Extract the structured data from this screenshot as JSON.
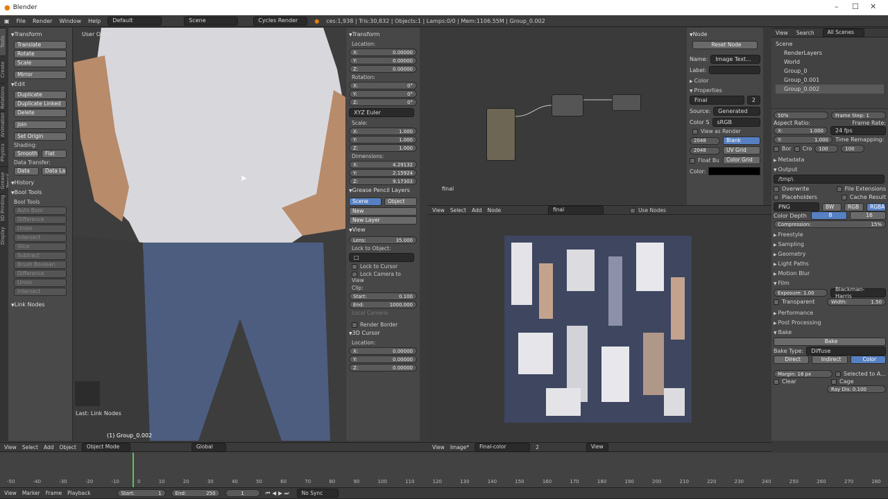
{
  "window": {
    "title": "Blender"
  },
  "menubar": {
    "items": [
      "File",
      "Render",
      "Window",
      "Help"
    ],
    "layout": "Default",
    "scene": "Scene",
    "engine": "Cycles Render",
    "stats": "ces:1,938 | Tris:30,832 | Objects:1 | Lamps:0/0 | Mem:1106.55M | Group_0.002"
  },
  "vtabs": [
    "Tools",
    "Create",
    "Relations",
    "Animation",
    "Physics",
    "Grease Pencil",
    "3D Printing",
    "Display"
  ],
  "toolshelf": {
    "transform": "Transform",
    "translate": "Translate",
    "rotate": "Rotate",
    "scale": "Scale",
    "mirror": "Mirror",
    "edit": "Edit",
    "duplicate": "Duplicate",
    "duplicate_linked": "Duplicate Linked",
    "delete": "Delete",
    "join": "Join",
    "set_origin": "Set Origin",
    "shading": "Shading:",
    "smooth": "Smooth",
    "flat": "Flat",
    "data_transfer": "Data Transfer:",
    "data": "Data",
    "data_la": "Data La",
    "history": "History",
    "bool_tools": "Bool Tools",
    "bool_tools_label": "Bool Tools",
    "bool_items": [
      "Auto Bool",
      "Difference",
      "Union",
      "Intersect",
      "Slice",
      "Subtract",
      "Brush Boolean",
      "Difference",
      "Union",
      "Intersect"
    ],
    "link_nodes": "Link Nodes"
  },
  "viewport": {
    "view_label": "User Ortho",
    "last_op": "Last: Link Nodes",
    "object_label": "(1) Group_0.002"
  },
  "npanel": {
    "transform": "Transform",
    "location": "Location:",
    "loc": [
      {
        "k": "X:",
        "v": "0.00000"
      },
      {
        "k": "Y:",
        "v": "0.00000"
      },
      {
        "k": "Z:",
        "v": "0.00000"
      }
    ],
    "rotation": "Rotation:",
    "rot": [
      {
        "k": "X:",
        "v": "0°"
      },
      {
        "k": "Y:",
        "v": "0°"
      },
      {
        "k": "Z:",
        "v": "0°"
      }
    ],
    "euler": "XYZ Euler",
    "scale": "Scale:",
    "scl": [
      {
        "k": "X:",
        "v": "1.000"
      },
      {
        "k": "Y:",
        "v": "1.000"
      },
      {
        "k": "Z:",
        "v": "1.000"
      }
    ],
    "dimensions": "Dimensions:",
    "dim": [
      {
        "k": "X:",
        "v": "4.29132"
      },
      {
        "k": "Y:",
        "v": "2.15924"
      },
      {
        "k": "Z:",
        "v": "9.17303"
      }
    ],
    "grease": "Grease Pencil Layers",
    "scene_btn": "Scene",
    "object_btn": "Object",
    "new": "New",
    "new_layer": "New Layer",
    "view": "View",
    "lens_k": "Lens:",
    "lens_v": "35.000",
    "lock_object": "Lock to Object:",
    "lock_cursor": "Lock to Cursor",
    "lock_camera": "Lock Camera to View",
    "clip": "Clip:",
    "start_k": "Start:",
    "start_v": "0.100",
    "end_k": "End:",
    "end_v": "1000.000",
    "local_camera": "Local Camera:",
    "render_border": "Render Border",
    "cursor3d": "3D Cursor",
    "cur_loc": "Location:",
    "cur": [
      {
        "k": "X:",
        "v": "0.00000"
      },
      {
        "k": "Y:",
        "v": "0.00000"
      },
      {
        "k": "Z:",
        "v": "0.00000"
      }
    ]
  },
  "nodeeditor": {
    "label": "final",
    "header": [
      "View",
      "Select",
      "Add",
      "Node"
    ],
    "tree": "final",
    "use_nodes": "Use Nodes"
  },
  "nodeprops": {
    "node": "Node",
    "reset": "Reset Node",
    "name_k": "Name:",
    "name_v": "Image Text...",
    "label_k": "Label:",
    "color": "Color",
    "properties": "Properties",
    "final": "Final",
    "final_num": "2",
    "source_k": "Source:",
    "source_v": "Generated",
    "colors_k": "Color S",
    "colors_v": "sRGB",
    "view_render": "View as Render",
    "w": "2048",
    "h": "2048",
    "blank": "Blank",
    "uvgrid": "UV Grid",
    "colorgrid": "Color Grid",
    "float": "Float Bu",
    "color_k": "Color:"
  },
  "outliner": {
    "header": [
      "View",
      "Search"
    ],
    "filter": "All Scenes",
    "items": [
      {
        "label": "Scene",
        "ind": 0
      },
      {
        "label": "RenderLayers",
        "ind": 1
      },
      {
        "label": "World",
        "ind": 1
      },
      {
        "label": "Group_0",
        "ind": 1
      },
      {
        "label": "Group_0.001",
        "ind": 1
      },
      {
        "label": "Group_0.002",
        "ind": 1
      }
    ]
  },
  "props": {
    "percent": "50%",
    "frame_step": "Frame Step: 1",
    "aspect": "Aspect Ratio:",
    "frame_rate": "Frame Rate:",
    "ax_k": "X:",
    "ax_v": "1.000",
    "ay_k": "Y:",
    "ay_v": "1.000",
    "fps": "24 fps",
    "time_remap": "Time Remapping:",
    "tr1": "100",
    "tr2": "100",
    "bor": "Bor",
    "crop": "Cro",
    "metadata": "Metadata",
    "output": "Output",
    "path": "/tmp\\",
    "overwrite": "Overwrite",
    "file_ext": "File Extensions",
    "placeholders": "Placeholders",
    "cache": "Cache Result",
    "format": "PNG",
    "bw": "BW",
    "rgb": "RGB",
    "rgba": "RGBA",
    "depth_k": "Color Depth",
    "d8": "8",
    "d16": "16",
    "compression": "Compression:",
    "comp_v": "15%",
    "sections": [
      "Freestyle",
      "Sampling",
      "Geometry",
      "Light Paths",
      "Motion Blur"
    ],
    "film": "Film",
    "exposure": "Exposure: 1.00",
    "filter": "Blackman-Harris",
    "transparent": "Transparent",
    "width": "Width:",
    "width_v": "1.50",
    "perf": "Performance",
    "post": "Post Processing",
    "bake": "Bake",
    "bake_btn": "Bake",
    "bake_type_k": "Bake Type:",
    "bake_type_v": "Diffuse",
    "direct": "Direct",
    "indirect": "Indirect",
    "color_btn": "Color",
    "margin": "Margin: 16 px",
    "sel_active": "Selected to A...",
    "clear": "Clear",
    "cage": "Cage",
    "ray": "Ray Dis: 0.100"
  },
  "imgeditor": {
    "header": [
      "View",
      "Image*"
    ],
    "image": "Final-color",
    "num": "2",
    "view": "View"
  },
  "viewheader": {
    "items": [
      "View",
      "Select",
      "Add",
      "Object"
    ],
    "mode": "Object Mode",
    "orient": "Global"
  },
  "timeline": {
    "ticks": [
      "-50",
      "-40",
      "-30",
      "-20",
      "-10",
      "0",
      "10",
      "20",
      "30",
      "40",
      "50",
      "60",
      "70",
      "80",
      "90",
      "100",
      "110",
      "120",
      "130",
      "140",
      "150",
      "160",
      "170",
      "180",
      "190",
      "200",
      "210",
      "220",
      "230",
      "240",
      "250",
      "260",
      "270",
      "280"
    ],
    "menu": [
      "View",
      "Marker",
      "Frame",
      "Playback"
    ],
    "start": "Start:",
    "start_v": "1",
    "end": "End:",
    "end_v": "250",
    "cur": "1",
    "sync": "No Sync"
  }
}
